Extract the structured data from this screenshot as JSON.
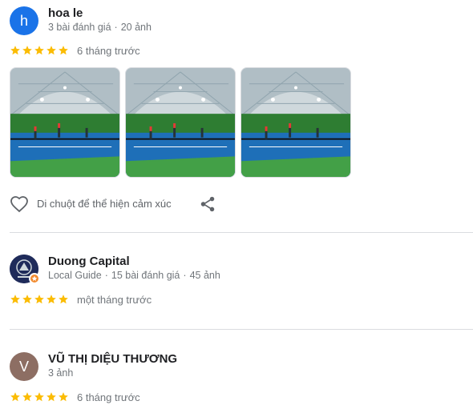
{
  "reviews": [
    {
      "initial": "h",
      "avatar_color": "#1a73e8",
      "name": "hoa le",
      "stats": "3 bài đánh giá",
      "photos_count": "20 ảnh",
      "rating": 5,
      "time": "6 tháng trước",
      "actions_label": "Di chuột để thể hiện cảm xúc",
      "photos": [
        {
          "icon": "photo-indoor-tennis-court-1"
        },
        {
          "icon": "photo-indoor-tennis-court-2"
        },
        {
          "icon": "photo-indoor-tennis-court-3"
        }
      ]
    },
    {
      "initial": "",
      "avatar_color": "#1f2b5a",
      "name": "Duong Capital",
      "guide": "Local Guide",
      "stats": "15 bài đánh giá",
      "photos_count": "45 ảnh",
      "rating": 5,
      "time": "một tháng trước"
    },
    {
      "initial": "V",
      "avatar_color": "#8d6e63",
      "name": "VŨ THỊ DIỆU THƯƠNG",
      "photos_count": "3 ảnh",
      "rating": 5,
      "time": "6 tháng trước"
    }
  ],
  "colors": {
    "star": "#fbbc04",
    "text_secondary": "#70757a",
    "divider": "#dadce0"
  },
  "icons": {
    "heart": "heart-outline-icon",
    "share": "share-icon",
    "guide_badge": "local-guide-star-icon"
  }
}
